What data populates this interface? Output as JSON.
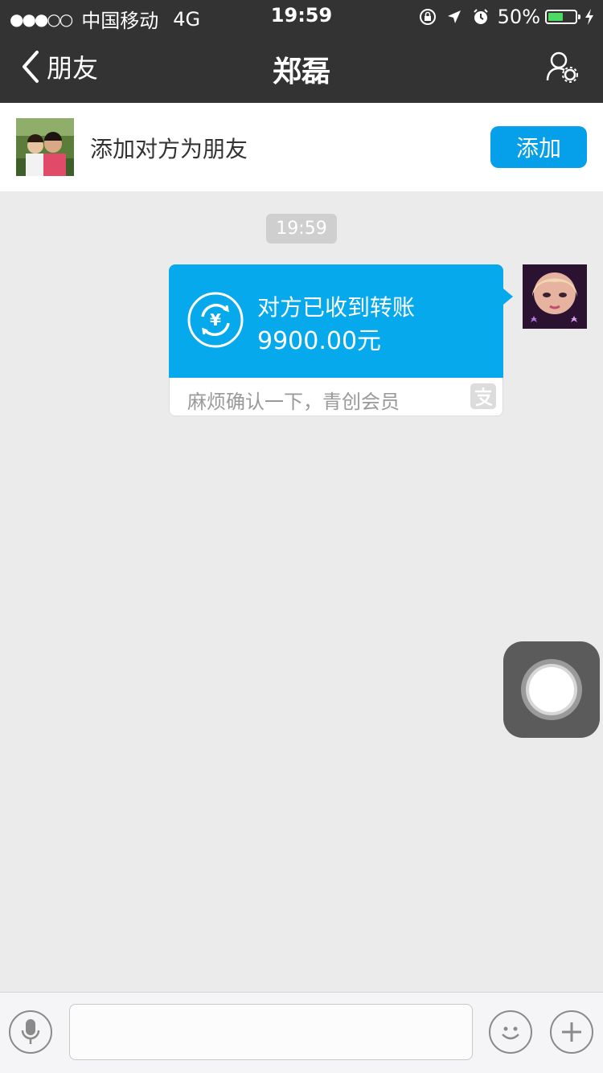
{
  "status_bar": {
    "signal": "●●●○○",
    "carrier": "中国移动",
    "network": "4G",
    "time": "19:59",
    "battery": "50%",
    "battery_level": 0.5
  },
  "nav": {
    "back_label": "朋友",
    "title": "郑磊",
    "settings_icon": "person-settings-icon"
  },
  "add_friend": {
    "prompt": "添加对方为朋友",
    "button_label": "添加"
  },
  "chat": {
    "timestamp": "19:59",
    "messages": [
      {
        "type": "transfer",
        "status": "对方已收到转账",
        "amount": "9900.00元",
        "note": "麻烦确认一下，青创会员",
        "brand_icon": "alipay-icon"
      }
    ]
  },
  "input_bar": {
    "voice_icon": "microphone-icon",
    "text_value": "",
    "emoji_icon": "smiley-icon",
    "plus_icon": "plus-icon"
  },
  "colors": {
    "nav_bg": "#333333",
    "accent": "#05a0e9",
    "bubble": "#05a9ec",
    "chat_bg": "#ebebeb"
  }
}
